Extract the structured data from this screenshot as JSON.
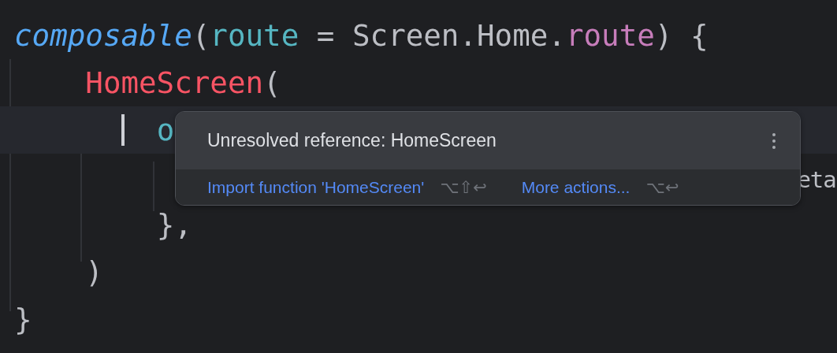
{
  "code_lines": [
    {
      "current": false,
      "tokens": [
        {
          "text": "composable",
          "kind": "call"
        },
        {
          "text": "(",
          "kind": "plain"
        },
        {
          "text": "route",
          "kind": "param"
        },
        {
          "text": " = Screen.Home.",
          "kind": "plain"
        },
        {
          "text": "route",
          "kind": "property"
        },
        {
          "text": ") {",
          "kind": "plain"
        }
      ]
    },
    {
      "current": false,
      "tokens": [
        {
          "text": "    HomeScreen",
          "kind": "error"
        },
        {
          "text": "(",
          "kind": "plain"
        }
      ]
    },
    {
      "current": true,
      "cursor": true,
      "tokens": [
        {
          "text": "        o",
          "kind": "param"
        }
      ]
    },
    {
      "current": false,
      "tokens": [
        {
          "text": "                                            eta",
          "kind": "plain"
        }
      ]
    },
    {
      "current": false,
      "tokens": [
        {
          "text": "        },",
          "kind": "plain"
        }
      ]
    },
    {
      "current": false,
      "tokens": [
        {
          "text": "    )",
          "kind": "plain"
        }
      ]
    },
    {
      "current": false,
      "tokens": [
        {
          "text": "}",
          "kind": "plain"
        }
      ]
    }
  ],
  "popup": {
    "message": "Unresolved reference: HomeScreen",
    "actions": [
      {
        "label": "Import function 'HomeScreen'",
        "shortcut": "⌥⇧↩"
      },
      {
        "label": "More actions...",
        "shortcut": "⌥↩"
      }
    ]
  }
}
